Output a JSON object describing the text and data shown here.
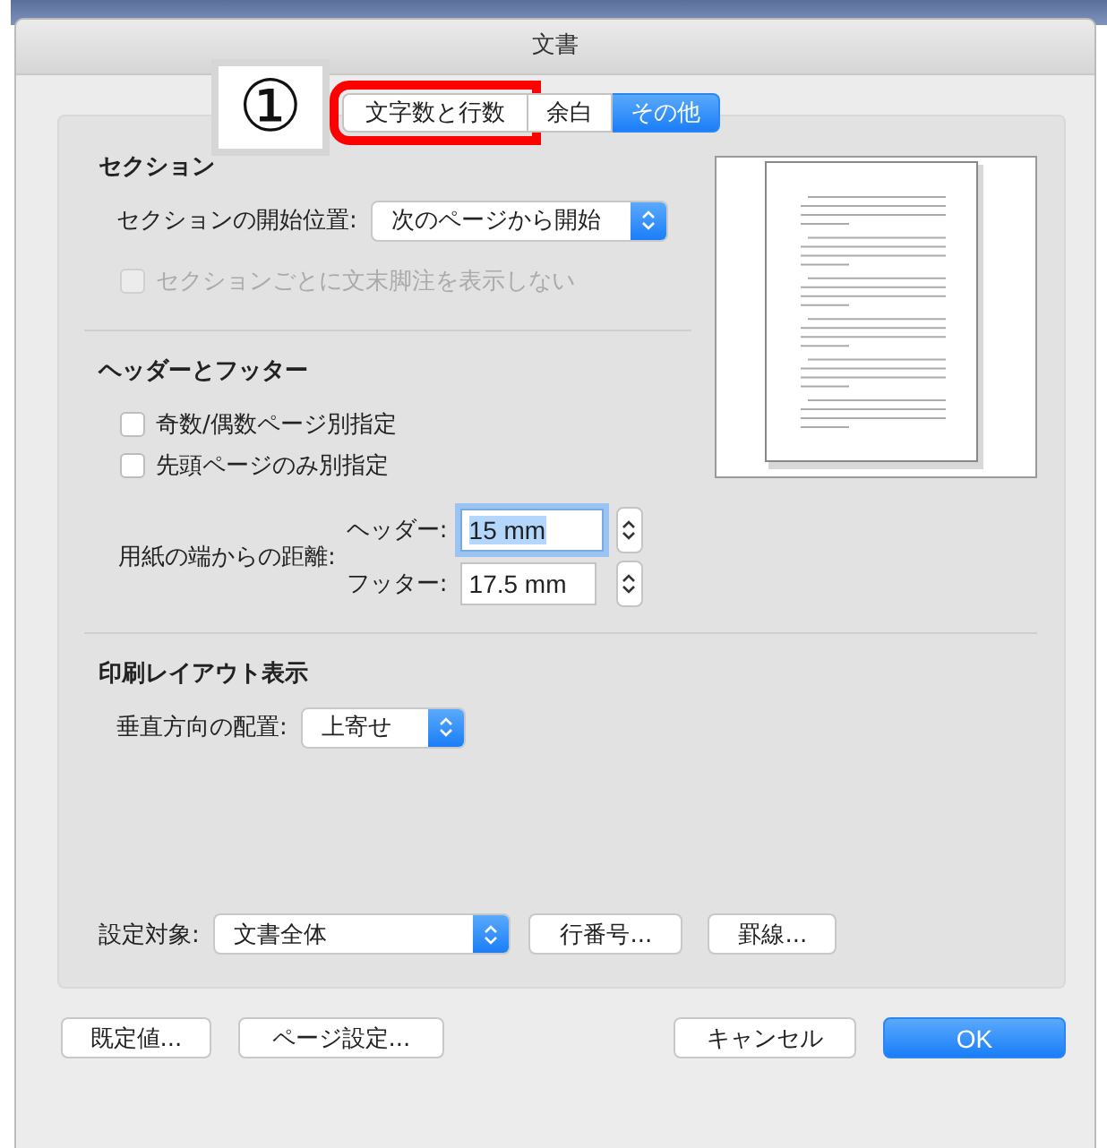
{
  "window": {
    "title": "文書"
  },
  "annotation": {
    "label": "①"
  },
  "tabs": [
    {
      "label": "文字数と行数",
      "selected": false,
      "highlighted": true
    },
    {
      "label": "余白",
      "selected": false,
      "highlighted": false
    },
    {
      "label": "その他",
      "selected": true,
      "highlighted": false
    }
  ],
  "sections": [
    {
      "title": "セクション",
      "rows": [
        {
          "kind": "popup",
          "label": "セクションの開始位置:",
          "value": "次のページから開始"
        },
        {
          "kind": "checkbox",
          "label": "セクションごとに文末脚注を表示しない",
          "checked": false,
          "disabled": true
        }
      ]
    },
    {
      "title": "ヘッダーとフッター",
      "rows": [
        {
          "kind": "checkbox",
          "label": "奇数/偶数ページ別指定",
          "checked": false,
          "disabled": false
        },
        {
          "kind": "checkbox",
          "label": "先頭ページのみ別指定",
          "checked": false,
          "disabled": false
        },
        {
          "kind": "distance",
          "label": "用紙の端からの距離:",
          "fields": [
            {
              "label": "ヘッダー:",
              "value": "15 mm",
              "focused": true
            },
            {
              "label": "フッター:",
              "value": "17.5 mm",
              "focused": false
            }
          ]
        }
      ]
    },
    {
      "title": "印刷レイアウト表示",
      "rows": [
        {
          "kind": "popup",
          "label": "垂直方向の配置:",
          "value": "上寄せ"
        }
      ]
    }
  ],
  "apply_to": {
    "label": "設定対象:",
    "value": "文書全体",
    "buttons": [
      "行番号...",
      "罫線..."
    ]
  },
  "dialog_buttons": {
    "left": [
      {
        "label": "既定値...",
        "primary": false
      },
      {
        "label": "ページ設定...",
        "primary": false
      }
    ],
    "right": [
      {
        "label": "キャンセル",
        "primary": false
      },
      {
        "label": "OK",
        "primary": true
      }
    ]
  }
}
